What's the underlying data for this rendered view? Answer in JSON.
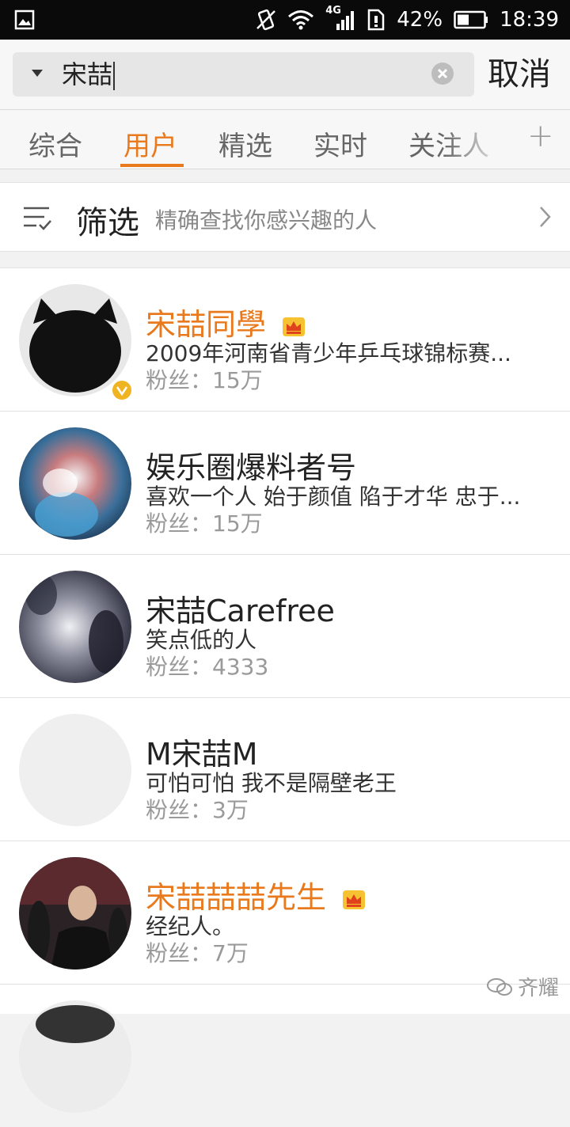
{
  "status_bar": {
    "network": "4G",
    "battery": "42%",
    "time": "18:39"
  },
  "search": {
    "query": "宋喆",
    "cancel_label": "取消"
  },
  "tabs": [
    {
      "label": "综合",
      "active": false
    },
    {
      "label": "用户",
      "active": true
    },
    {
      "label": "精选",
      "active": false
    },
    {
      "label": "实时",
      "active": false
    },
    {
      "label": "关注人",
      "active": false
    }
  ],
  "tabs_add_label": "+",
  "filter": {
    "title": "筛选",
    "subtitle": "精确查找你感兴趣的人"
  },
  "users": [
    {
      "name": "宋喆同學",
      "desc": "2009年河南省青少年乒乓球锦标赛...",
      "fans": "粉丝：15万",
      "vip": true,
      "verified": true
    },
    {
      "name": "娱乐圈爆料者号",
      "desc": "喜欢一个人 始于颜值 陷于才华 忠于...",
      "fans": "粉丝：15万",
      "vip": false,
      "verified": false
    },
    {
      "name": "宋喆Carefree",
      "desc": "笑点低的人",
      "fans": "粉丝：4333",
      "vip": false,
      "verified": false
    },
    {
      "name": "M宋喆M",
      "desc": "可怕可怕   我不是隔壁老王",
      "fans": "粉丝：3万",
      "vip": false,
      "verified": false
    },
    {
      "name": "宋喆喆喆先生",
      "desc": "经纪人。",
      "fans": "粉丝：7万",
      "vip": true,
      "verified": false
    }
  ],
  "watermark": "齐耀",
  "colors": {
    "accent": "#e8791d",
    "verified_badge": "#f0b423"
  }
}
